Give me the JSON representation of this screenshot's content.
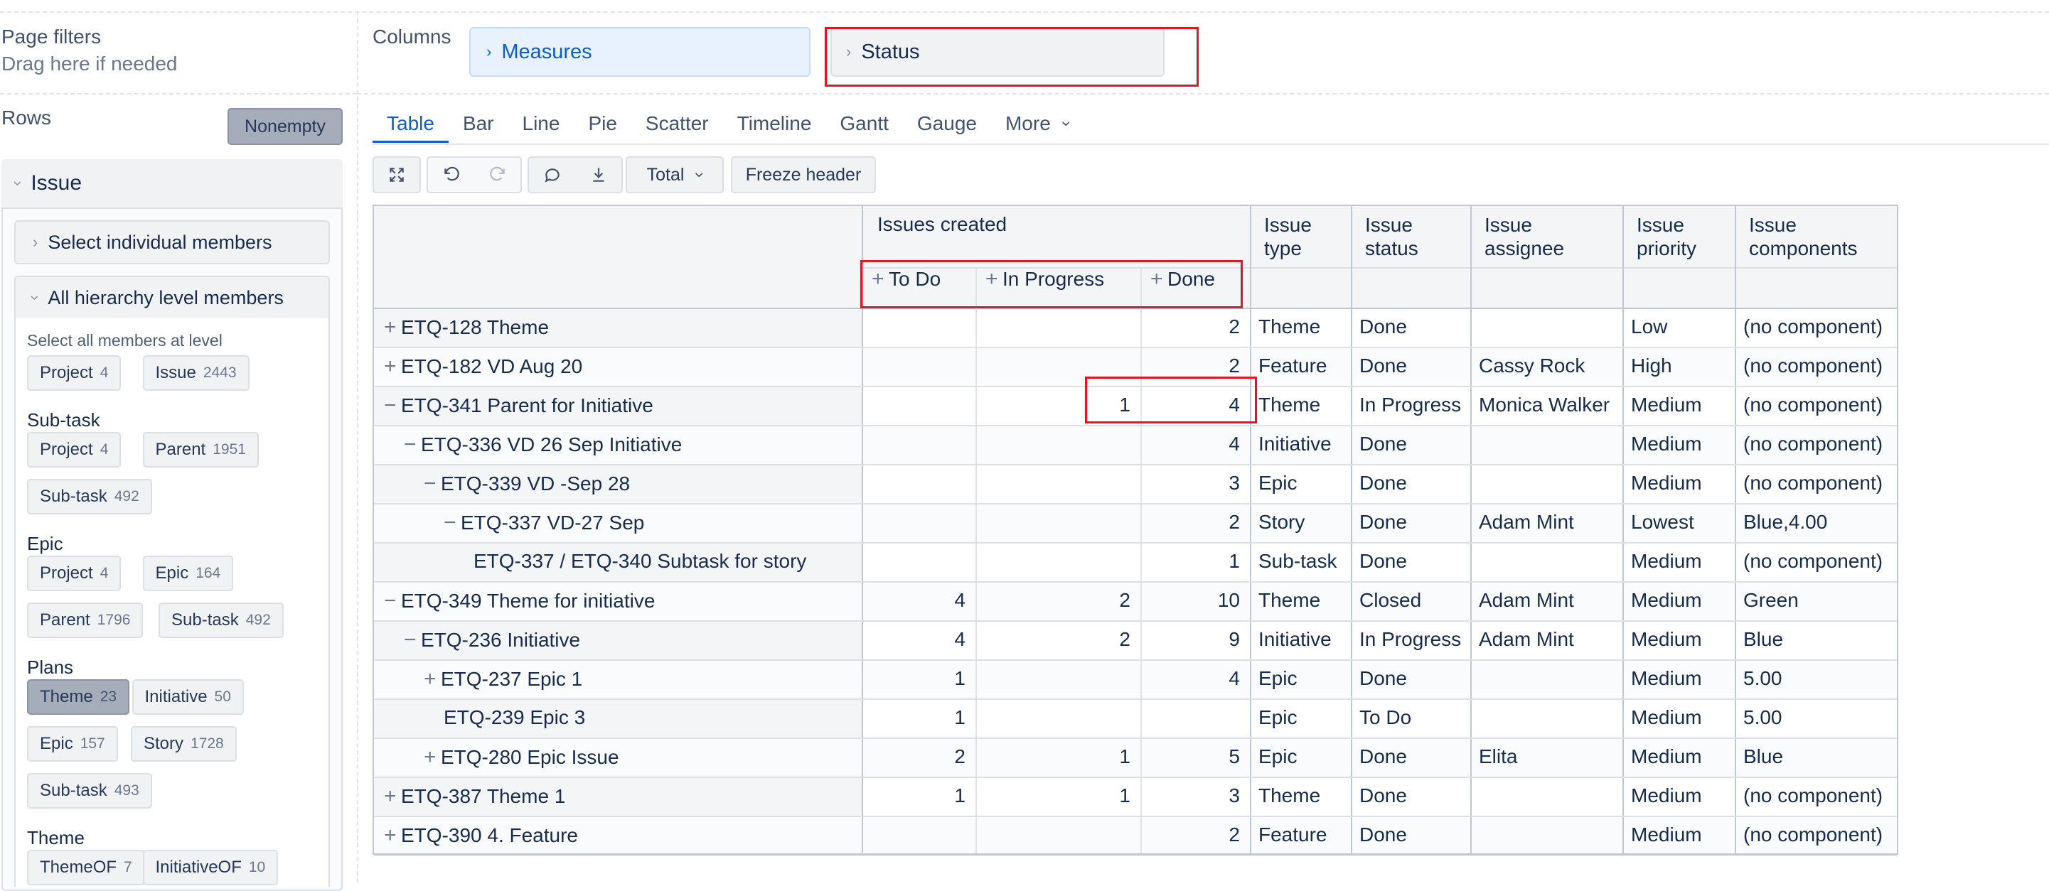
{
  "page_filters": {
    "title": "Page filters",
    "hint": "Drag here if needed"
  },
  "columns": {
    "label": "Columns",
    "chips": [
      "Measures",
      "Status"
    ]
  },
  "rows": {
    "label": "Rows",
    "nonempty_button": "Nonempty"
  },
  "issue_dimension": {
    "title": "Issue",
    "select_individual": "Select individual members",
    "all_hierarchy": "All hierarchy level members",
    "select_all_hint": "Select all members at level",
    "default_levels": [
      {
        "name": "Project",
        "count": "4"
      },
      {
        "name": "Issue",
        "count": "2443"
      }
    ],
    "groups": [
      {
        "title": "Sub-task",
        "levels": [
          {
            "name": "Project",
            "count": "4"
          },
          {
            "name": "Parent",
            "count": "1951"
          },
          {
            "name": "Sub-task",
            "count": "492"
          }
        ]
      },
      {
        "title": "Epic",
        "levels": [
          {
            "name": "Project",
            "count": "4"
          },
          {
            "name": "Epic",
            "count": "164"
          },
          {
            "name": "Parent",
            "count": "1796"
          },
          {
            "name": "Sub-task",
            "count": "492"
          }
        ]
      },
      {
        "title": "Plans",
        "levels": [
          {
            "name": "Theme",
            "count": "23",
            "active": true
          },
          {
            "name": "Initiative",
            "count": "50"
          },
          {
            "name": "Epic",
            "count": "157"
          },
          {
            "name": "Story",
            "count": "1728"
          },
          {
            "name": "Sub-task",
            "count": "493"
          }
        ]
      },
      {
        "title": "Theme",
        "levels": [
          {
            "name": "ThemeOF",
            "count": "7"
          },
          {
            "name": "InitiativeOF",
            "count": "10"
          }
        ]
      }
    ]
  },
  "view_tabs": [
    "Table",
    "Bar",
    "Line",
    "Pie",
    "Scatter",
    "Timeline",
    "Gantt",
    "Gauge",
    "More"
  ],
  "active_tab": "Table",
  "toolbar": {
    "total_label": "Total",
    "freeze_label": "Freeze header"
  },
  "table": {
    "measure_header": "Issues created",
    "status_headers": [
      "To Do",
      "In Progress",
      "Done"
    ],
    "property_headers": [
      [
        "Issue",
        "type"
      ],
      [
        "Issue",
        "status"
      ],
      [
        "Issue",
        "assignee"
      ],
      [
        "Issue",
        "priority"
      ],
      [
        "Issue",
        "components"
      ]
    ],
    "rows": [
      {
        "label": "ETQ-128 Theme",
        "indent": 0,
        "exp": "+",
        "todo": "",
        "inprog": "",
        "done": "2",
        "type": "Theme",
        "status": "Done",
        "assignee": "",
        "priority": "Low",
        "components": "(no component)"
      },
      {
        "label": "ETQ-182 VD Aug 20",
        "indent": 0,
        "exp": "+",
        "todo": "",
        "inprog": "",
        "done": "2",
        "type": "Feature",
        "status": "Done",
        "assignee": "Cassy Rock",
        "priority": "High",
        "components": "(no component)"
      },
      {
        "label": "ETQ-341 Parent for Initiative",
        "indent": 0,
        "exp": "−",
        "todo": "",
        "inprog": "1",
        "done": "4",
        "type": "Theme",
        "status": "In Progress",
        "assignee": "Monica Walker",
        "priority": "Medium",
        "components": "(no component)"
      },
      {
        "label": "ETQ-336 VD 26 Sep Initiative",
        "indent": 1,
        "exp": "−",
        "todo": "",
        "inprog": "",
        "done": "4",
        "type": "Initiative",
        "status": "Done",
        "assignee": "",
        "priority": "Medium",
        "components": "(no component)"
      },
      {
        "label": "ETQ-339 VD -Sep 28",
        "indent": 2,
        "exp": "−",
        "todo": "",
        "inprog": "",
        "done": "3",
        "type": "Epic",
        "status": "Done",
        "assignee": "",
        "priority": "Medium",
        "components": "(no component)"
      },
      {
        "label": "ETQ-337 VD-27 Sep",
        "indent": 3,
        "exp": "−",
        "todo": "",
        "inprog": "",
        "done": "2",
        "type": "Story",
        "status": "Done",
        "assignee": "Adam Mint",
        "priority": "Lowest",
        "components": "Blue,4.00"
      },
      {
        "label": "ETQ-337 / ETQ-340 Subtask for story",
        "indent": 4,
        "exp": "",
        "todo": "",
        "inprog": "",
        "done": "1",
        "type": "Sub-task",
        "status": "Done",
        "assignee": "",
        "priority": "Medium",
        "components": "(no component)"
      },
      {
        "label": "ETQ-349 Theme for initiative",
        "indent": 0,
        "exp": "−",
        "todo": "4",
        "inprog": "2",
        "done": "10",
        "type": "Theme",
        "status": "Closed",
        "assignee": "Adam Mint",
        "priority": "Medium",
        "components": "Green"
      },
      {
        "label": "ETQ-236 Initiative",
        "indent": 1,
        "exp": "−",
        "todo": "4",
        "inprog": "2",
        "done": "9",
        "type": "Initiative",
        "status": "In Progress",
        "assignee": "Adam Mint",
        "priority": "Medium",
        "components": "Blue"
      },
      {
        "label": "ETQ-237 Epic 1",
        "indent": 2,
        "exp": "+",
        "todo": "1",
        "inprog": "",
        "done": "4",
        "type": "Epic",
        "status": "Done",
        "assignee": "",
        "priority": "Medium",
        "components": "5.00"
      },
      {
        "label": "ETQ-239 Epic 3",
        "indent": 2,
        "exp": "",
        "todo": "1",
        "inprog": "",
        "done": "",
        "type": "Epic",
        "status": "To Do",
        "assignee": "",
        "priority": "Medium",
        "components": "5.00"
      },
      {
        "label": "ETQ-280 Epic Issue",
        "indent": 2,
        "exp": "+",
        "todo": "2",
        "inprog": "1",
        "done": "5",
        "type": "Epic",
        "status": "Done",
        "assignee": "Elita",
        "priority": "Medium",
        "components": "Blue"
      },
      {
        "label": "ETQ-387 Theme 1",
        "indent": 0,
        "exp": "+",
        "todo": "1",
        "inprog": "1",
        "done": "3",
        "type": "Theme",
        "status": "Done",
        "assignee": "",
        "priority": "Medium",
        "components": "(no component)"
      },
      {
        "label": "ETQ-390 4. Feature",
        "indent": 0,
        "exp": "+",
        "todo": "",
        "inprog": "",
        "done": "2",
        "type": "Feature",
        "status": "Done",
        "assignee": "",
        "priority": "Medium",
        "components": "(no component)"
      }
    ]
  },
  "colors": {
    "accent": "#0b5cd5",
    "highlight_box": "#e5141e",
    "chip_blue_bg": "#e8f2ff"
  }
}
